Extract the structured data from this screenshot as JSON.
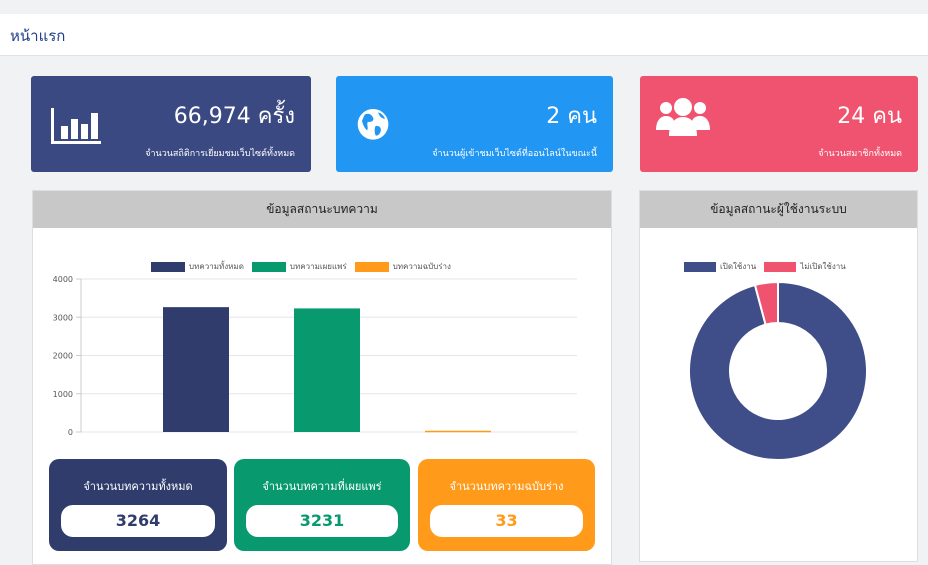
{
  "page": {
    "title": "หน้าแรก"
  },
  "stats": [
    {
      "value": "66,974 ครั้ง",
      "label": "จำนวนสถิติการเยี่ยมชมเว็บไซต์ทั้งหมด",
      "color": "#3b4983",
      "icon": "bar-chart-icon"
    },
    {
      "value": "2 คน",
      "label": "จำนวนผู้เข้าชมเว็บไซต์ที่ออนไลน์ในขณะนี้",
      "color": "#2196f3",
      "icon": "globe-icon"
    },
    {
      "value": "24 คน",
      "label": "จำนวนสมาชิกทั้งหมด",
      "color": "#ef536f",
      "icon": "users-icon"
    }
  ],
  "articles_panel": {
    "title": "ข้อมูลสถานะบทความ"
  },
  "users_panel": {
    "title": "ข้อมูลสถานะผู้ใช้งานระบบ"
  },
  "counters": [
    {
      "label": "จำนวนบทความทั้งหมด",
      "value": "3264",
      "color": "#2f3c6c"
    },
    {
      "label": "จำนวนบทความที่เผยแพร่",
      "value": "3231",
      "color": "#089a6e"
    },
    {
      "label": "จำนวนบทความฉบับร่าง",
      "value": "33",
      "color": "#ff9a1a"
    }
  ],
  "chart_data": [
    {
      "type": "bar",
      "categories": [
        "บทความทั้งหมด",
        "บทความเผยแพร่",
        "บทความฉบับร่าง"
      ],
      "series": [
        {
          "name": "บทความทั้งหมด",
          "values": [
            3264,
            null,
            null
          ],
          "color": "#2f3c6c"
        },
        {
          "name": "บทความเผยแพร่",
          "values": [
            null,
            3231,
            null
          ],
          "color": "#089a6e"
        },
        {
          "name": "บทความฉบับร่าง",
          "values": [
            null,
            null,
            33
          ],
          "color": "#ff9a1a"
        }
      ],
      "yticks": [
        "0",
        "1000",
        "2000",
        "3000",
        "4000"
      ],
      "ylim": [
        0,
        4000
      ],
      "grid": true,
      "legend": "top"
    },
    {
      "type": "pie",
      "variant": "doughnut",
      "labels": [
        "เปิดใช้งาน",
        "ไม่เปิดใช้งาน"
      ],
      "values": [
        23,
        1
      ],
      "colors": [
        "#3f4e88",
        "#ef536f"
      ],
      "legend": "top"
    }
  ]
}
